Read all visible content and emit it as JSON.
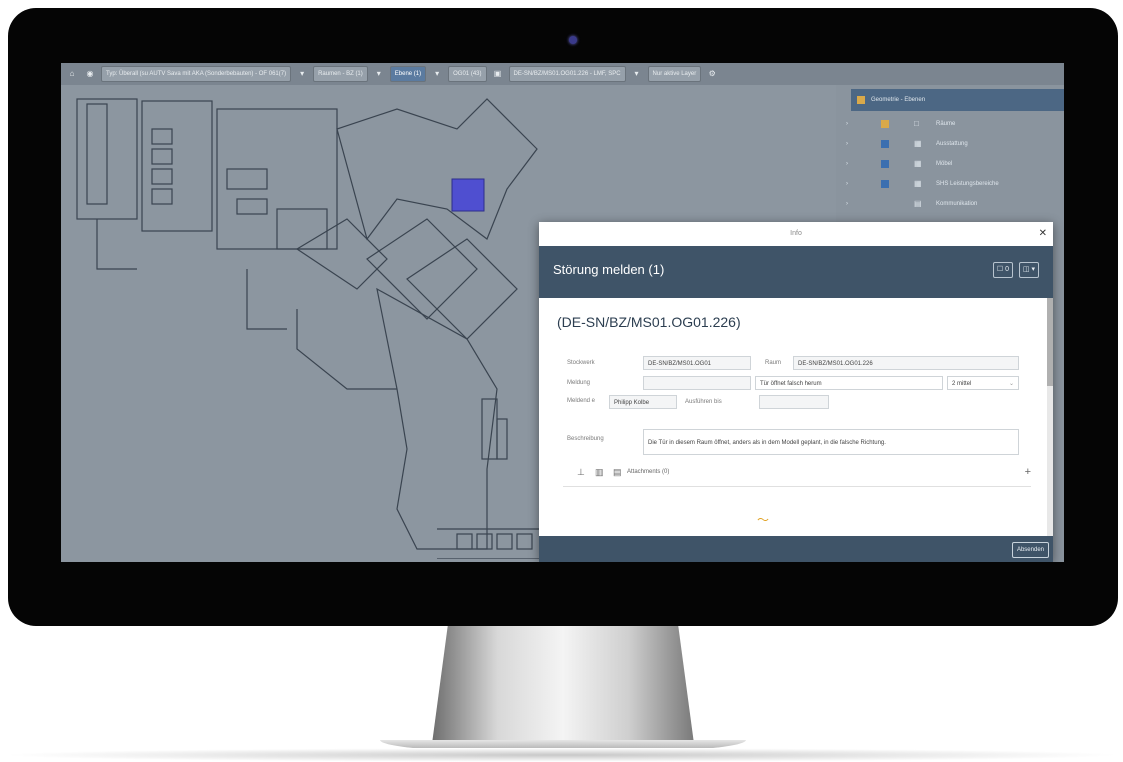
{
  "toolbar": {
    "chips": [
      "Typ: Überall (su AUTV Sava mit AKA (Sonderbebauten) - OF 061(7)",
      "Raumen - BZ (1)",
      "Ebene (1)",
      "OG01 (43)"
    ],
    "model_path": "DE-SN/BZ/MS01.OG01.226 - LMF, SPC",
    "layer_select": "Nur aktive Layer"
  },
  "layers": {
    "header": "Geometrie - Ebenen",
    "items": [
      {
        "label": "Räume",
        "color": "#d9a94a"
      },
      {
        "label": "Ausstattung",
        "color": "#3b6fb0"
      },
      {
        "label": "Möbel",
        "color": "#3b6fb0"
      },
      {
        "label": "SHS Leistungsbereiche",
        "color": "#3b6fb0"
      },
      {
        "label": "Kommunikation",
        "color": "#d9a94a"
      }
    ]
  },
  "dialog": {
    "window_title": "Info",
    "header_title": "Störung melden (1)",
    "header_count_btn": "0",
    "object_title": "(DE-SN/BZ/MS01.OG01.226)",
    "fields": {
      "stockwerk_label": "Stockwerk",
      "stockwerk_value": "DE-SN/BZ/MS01.OG01",
      "raum_label": "Raum",
      "raum_value": "DE-SN/BZ/MS01.OG01.226",
      "meldung_label": "Meldung",
      "meldung_value": "",
      "problem_value": "Tür öffnet falsch herum",
      "priority_value": "2 mittel",
      "meldende_label": "Meldend e",
      "meldende_value": "Philipp Kolbe",
      "ausfuehren_label": "Ausführen bis",
      "ausfuehren_value": "",
      "beschreibung_label": "Beschreibung",
      "beschreibung_value": "Die Tür in diesem Raum öffnet, anders als in dem Modell geplant, in die falsche Richtung."
    },
    "attachments_label": "Attachments (0)",
    "add_symbol": "+",
    "send_label": "Absenden"
  },
  "colors": {
    "dialog_header": "#3f5468",
    "highlight_room": "#4f4fd0",
    "layer_header": "#4c6784"
  }
}
